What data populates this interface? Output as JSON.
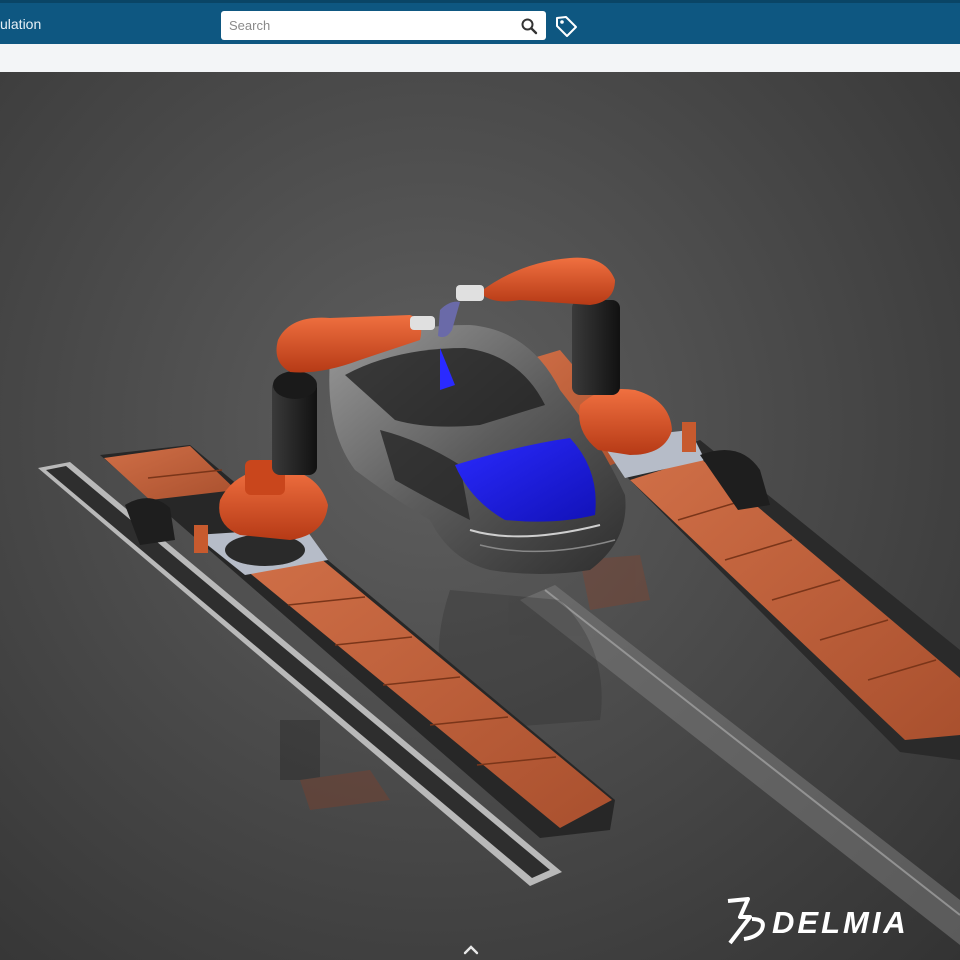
{
  "app": {
    "title": "ulation"
  },
  "search": {
    "placeholder": "Search",
    "value": ""
  },
  "icons": {
    "search": "search-icon",
    "tag": "tag-icon",
    "scroll_up": "chevron-up-icon",
    "brand_logo": "3ds-logo-icon"
  },
  "brand": {
    "name": "DELMIA"
  },
  "colors": {
    "header": "#0e5781",
    "robot": "#d8552a",
    "track_panel": "#c5663f",
    "highlight": "#1f1fe0",
    "background": "#444444"
  }
}
